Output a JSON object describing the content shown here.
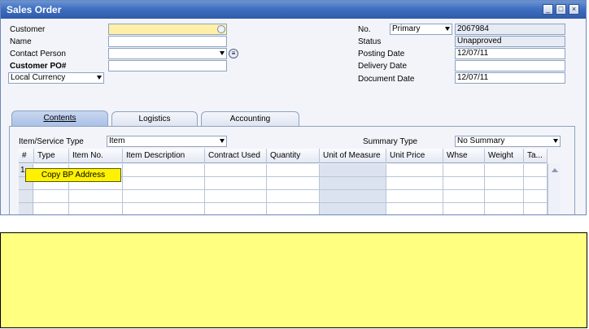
{
  "window": {
    "title": "Sales Order",
    "buttons": {
      "minimize": "_",
      "maximize": "□",
      "close": "×"
    }
  },
  "header_left": {
    "customer_label": "Customer",
    "customer_value": "",
    "name_label": "Name",
    "name_value": "",
    "contact_label": "Contact Person",
    "contact_value": "",
    "customer_po_label": "Customer PO#",
    "customer_po_value": "",
    "currency_value": "Local Currency"
  },
  "header_right": {
    "no_label": "No.",
    "series_value": "Primary",
    "no_value": "2067984",
    "status_label": "Status",
    "status_value": "Unapproved",
    "posting_label": "Posting Date",
    "posting_value": "12/07/11",
    "delivery_label": "Delivery Date",
    "delivery_value": "",
    "document_label": "Document Date",
    "document_value": "12/07/11"
  },
  "tabs": [
    {
      "label": "Contents",
      "active": true
    },
    {
      "label": "Logistics",
      "active": false
    },
    {
      "label": "Accounting",
      "active": false
    }
  ],
  "contents": {
    "item_type_label": "Item/Service Type",
    "item_type_value": "Item",
    "summary_label": "Summary Type",
    "summary_value": "No Summary"
  },
  "grid": {
    "columns": [
      "#",
      "Type",
      "Item No.",
      "Item Description",
      "Contract Used",
      "Quantity",
      "Unit of Measure",
      "Unit Price",
      "Whse",
      "Weight",
      "Ta..."
    ],
    "first_row_number": "1"
  },
  "popup": {
    "label": "Copy BP Address"
  },
  "colors": {
    "titlebar": "#3f6fc1",
    "window_bg": "#f2f4f9",
    "popup_bg": "#fff200",
    "note_bg": "#ffff80",
    "highlight_field": "#fff0a8"
  }
}
